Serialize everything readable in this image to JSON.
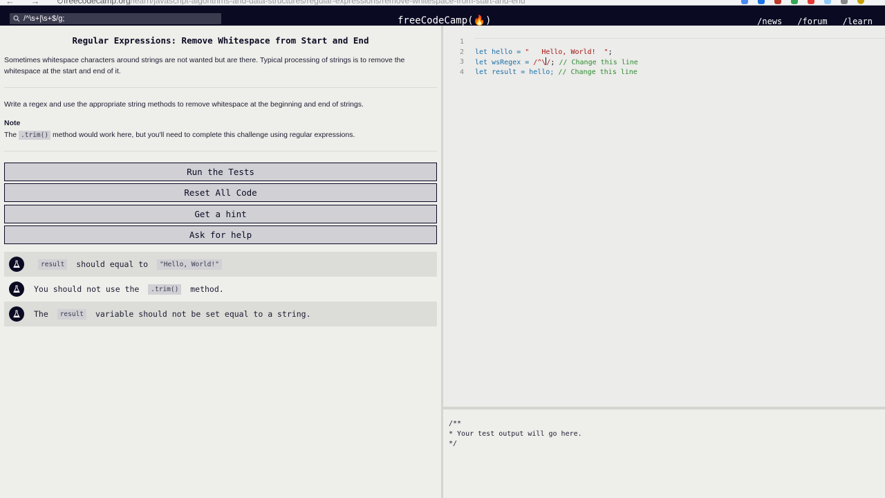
{
  "browser": {
    "url_host": "freecodecamp.org",
    "url_path": "/learn/javascript-algorithms-and-data-structures/regular-expressions/remove-whitespace-from-start-and-end"
  },
  "navbar": {
    "search_text": "/^\\s+|\\s+$/g;",
    "logo": "freeCodeCamp(🔥)",
    "links": [
      "/news",
      "/forum",
      "/learn"
    ]
  },
  "challenge": {
    "title": "Regular Expressions: Remove Whitespace from Start and End",
    "description": "Sometimes whitespace characters around strings are not wanted but are there. Typical processing of strings is to remove the whitespace at the start and end of it.",
    "instructions": "Write a regex and use the appropriate string methods to remove whitespace at the beginning and end of strings.",
    "note_heading": "Note",
    "note_before": "The ",
    "note_code": ".trim()",
    "note_after": " method would work here, but you'll need to complete this challenge using regular expressions."
  },
  "buttons": {
    "run": "Run the Tests",
    "reset": "Reset All Code",
    "hint": "Get a hint",
    "help": "Ask for help"
  },
  "tests": [
    {
      "code1": "result",
      "text1": " should equal to ",
      "code2": "\"Hello, World!\"",
      "text2": ""
    },
    {
      "text0": "You should not use the ",
      "code1": ".trim()",
      "text1": " method."
    },
    {
      "text0": "The ",
      "code1": "result",
      "text1": " variable should not be set equal to a string."
    }
  ],
  "editor": {
    "line_numbers": [
      "1",
      "2",
      "3",
      "4"
    ],
    "l1_kw": "let hello = ",
    "l1_str": "\"   Hello, World!  \"",
    "l1_end": ";",
    "l2_kw": "let wsRegex = ",
    "l2_str": "/^\\",
    "l2_str2": "/",
    "l2_end": "; ",
    "l2_cmt": "// Change this line",
    "l3_kw": "let result = hello; ",
    "l3_cmt": "// Change this line"
  },
  "output": {
    "text": "/**\n* Your test output will go here.\n*/"
  },
  "colors": {
    "navbar_bg": "#0a0a23",
    "button_bg": "#d0d0d5",
    "comment": "#2e8b2e",
    "string": "#a31515",
    "keyword": "#1b6ea8"
  }
}
